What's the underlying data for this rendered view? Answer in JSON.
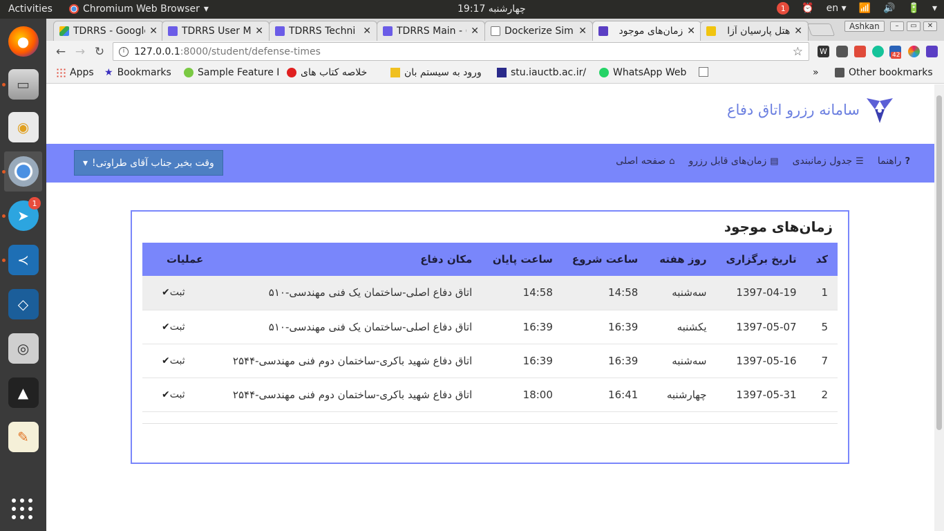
{
  "topbar": {
    "activities": "Activities",
    "app_name": "Chromium Web Browser",
    "clock": "چهارشنبه 19:17",
    "notif_count": "1",
    "lang": "en"
  },
  "dock": {
    "telegram_badge": "1"
  },
  "tabs": [
    {
      "title": "TDRRS - Google",
      "color": "#1fa463"
    },
    {
      "title": "TDRRS User M",
      "color": "#6b5ce7"
    },
    {
      "title": "TDRRS Techni",
      "color": "#6b5ce7"
    },
    {
      "title": "TDRRS Main - (",
      "color": "#6b5ce7"
    },
    {
      "title": "Dockerize Sim",
      "color": "#ffffff"
    },
    {
      "title": "زمان‌های موجود",
      "color": "#5b3fc4"
    },
    {
      "title": "هتل پارسیان آزا",
      "color": "#f1c40f"
    }
  ],
  "window": {
    "user": "Ashkan"
  },
  "omnibox": {
    "host": "127.0.0.1",
    "path": ":8000/student/defense-times"
  },
  "extensions": {
    "badge_count": "42"
  },
  "bookmarks": {
    "apps": "Apps",
    "bookmarks": "Bookmarks",
    "sample": "Sample Feature I",
    "khollase": "خلاصه کتاب های",
    "vorood": "ورود به سیستم بان",
    "stu": "stu.iauctb.ac.ir/",
    "whatsapp": "WhatsApp Web",
    "more": "»",
    "other": "Other bookmarks"
  },
  "site": {
    "title": "سامانه رزرو اتاق دفاع",
    "greeting": "وقت بخیر جناب آقای طراوتی!",
    "nav": {
      "home": "صفحه اصلی",
      "reservable": "زمان‌های قابل رزرو",
      "schedule": "جدول زمانبندی",
      "help": "راهنما"
    }
  },
  "panel": {
    "title": "زمان‌های موجود",
    "headers": {
      "code": "کد",
      "date": "تاریخ برگزاری",
      "weekday": "روز هفته",
      "start": "ساعت شروع",
      "end": "ساعت پایان",
      "place": "مکان دفاع",
      "ops": "عملیات"
    },
    "rows": [
      {
        "code": "1",
        "date": "1397-04-19",
        "weekday": "سه‌شنبه",
        "start": "14:58",
        "end": "14:58",
        "place": "اتاق دفاع اصلی-ساختمان یک فنی مهندسی-۵۱۰",
        "action": "ثبت"
      },
      {
        "code": "5",
        "date": "1397-05-07",
        "weekday": "یکشنبه",
        "start": "16:39",
        "end": "16:39",
        "place": "اتاق دفاع اصلی-ساختمان یک فنی مهندسی-۵۱۰",
        "action": "ثبت"
      },
      {
        "code": "7",
        "date": "1397-05-16",
        "weekday": "سه‌شنبه",
        "start": "16:39",
        "end": "16:39",
        "place": "اتاق دفاع شهید باکری-ساختمان دوم فنی مهندسی-۲۵۴۴",
        "action": "ثبت"
      },
      {
        "code": "2",
        "date": "1397-05-31",
        "weekday": "چهارشنبه",
        "start": "16:41",
        "end": "18:00",
        "place": "اتاق دفاع شهید باکری-ساختمان دوم فنی مهندسی-۲۵۴۴",
        "action": "ثبت"
      }
    ]
  }
}
